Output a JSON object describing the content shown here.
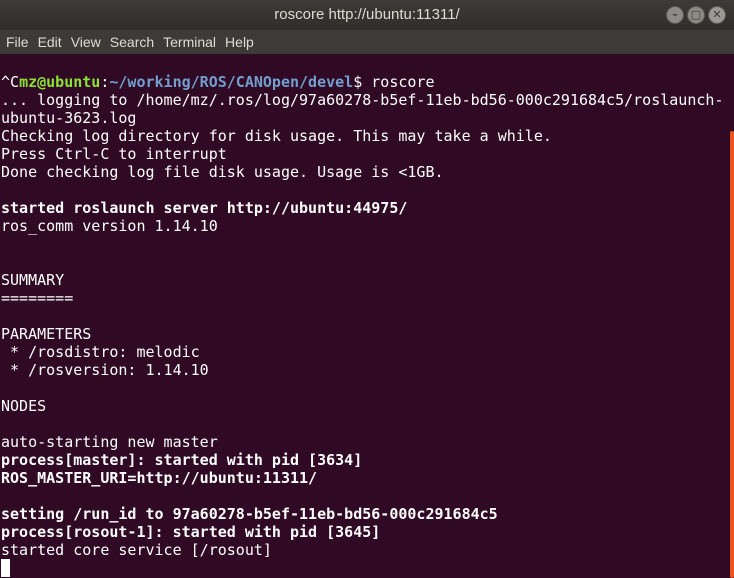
{
  "window": {
    "title": "roscore http://ubuntu:11311/",
    "controls": {
      "minimize": "–",
      "maximize": "□",
      "close": "✕"
    }
  },
  "menu": [
    "File",
    "Edit",
    "View",
    "Search",
    "Terminal",
    "Help"
  ],
  "prompt": {
    "prefix": "^C",
    "user": "mz@ubuntu",
    "colon": ":",
    "path": "~/working/ROS/CANOpen/devel",
    "symbol": "$ ",
    "command": "roscore"
  },
  "lines": [
    {
      "text": "... logging to /home/mz/.ros/log/97a60278-b5ef-11eb-bd56-000c291684c5/roslaunch-",
      "bold": false
    },
    {
      "text": "ubuntu-3623.log",
      "bold": false
    },
    {
      "text": "Checking log directory for disk usage. This may take a while.",
      "bold": false
    },
    {
      "text": "Press Ctrl-C to interrupt",
      "bold": false
    },
    {
      "text": "Done checking log file disk usage. Usage is <1GB.",
      "bold": false
    },
    {
      "text": "",
      "bold": false
    },
    {
      "text": "started roslaunch server http://ubuntu:44975/",
      "bold": true
    },
    {
      "text": "ros_comm version 1.14.10",
      "bold": false
    },
    {
      "text": "",
      "bold": false
    },
    {
      "text": "",
      "bold": false
    },
    {
      "text": "SUMMARY",
      "bold": false
    },
    {
      "text": "========",
      "bold": false
    },
    {
      "text": "",
      "bold": false
    },
    {
      "text": "PARAMETERS",
      "bold": false
    },
    {
      "text": " * /rosdistro: melodic",
      "bold": false
    },
    {
      "text": " * /rosversion: 1.14.10",
      "bold": false
    },
    {
      "text": "",
      "bold": false
    },
    {
      "text": "NODES",
      "bold": false
    },
    {
      "text": "",
      "bold": false
    },
    {
      "text": "auto-starting new master",
      "bold": false
    },
    {
      "text": "process[master]: started with pid [3634]",
      "bold": true
    },
    {
      "text": "ROS_MASTER_URI=http://ubuntu:11311/",
      "bold": true
    },
    {
      "text": "",
      "bold": false
    },
    {
      "text": "setting /run_id to 97a60278-b5ef-11eb-bd56-000c291684c5",
      "bold": true
    },
    {
      "text": "process[rosout-1]: started with pid [3645]",
      "bold": true
    },
    {
      "text": "started core service [/rosout]",
      "bold": false
    }
  ],
  "colors": {
    "background": "#300a24",
    "prompt_user": "#8ae234",
    "prompt_path": "#729fcf",
    "scrollbar": "#e95420"
  }
}
